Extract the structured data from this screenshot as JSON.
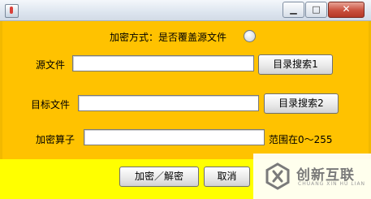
{
  "window": {
    "minimize_glyph": "▁",
    "maximize_glyph": "□",
    "close_glyph": "✕"
  },
  "form": {
    "encryption_mode_label": "加密方式：是否覆盖源文件",
    "overwrite_radio_checked": false,
    "source_file_label": "源文件",
    "source_file_value": "",
    "browse_source_button": "目录搜索1",
    "target_file_label": "目标文件",
    "target_file_value": "",
    "browse_target_button": "目录搜索2",
    "cipher_operator_label": "加密算子",
    "cipher_operator_value": "",
    "range_hint": "范围在0～255"
  },
  "actions": {
    "encrypt_decrypt_button": "加密／解密",
    "cancel_button": "取消"
  },
  "watermark": {
    "text": "创新互联",
    "subtext": "CHUANG XIN HU LIAN"
  },
  "colors": {
    "panel": "#ffc200",
    "bottom_band": "#ffff00"
  }
}
